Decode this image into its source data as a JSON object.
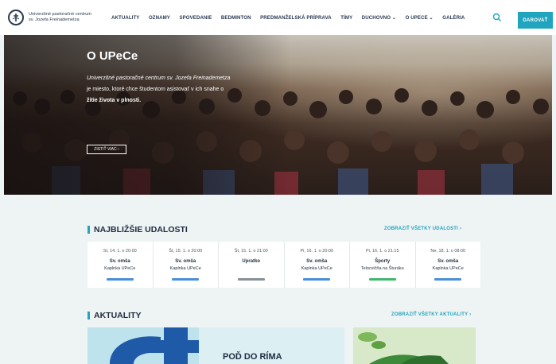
{
  "header": {
    "logo_line1": "Univerzitné pastoračné centrum",
    "logo_line2": "sv. Jozefa Freinademetza",
    "nav": [
      "AKTUALITY",
      "OZNAMY",
      "SPOVEDANIE",
      "BEDMINTON",
      "PREDMANŽELSKÁ PRÍPRAVA",
      "TÍMY",
      "DUCHOVNO ⌄",
      "O UPECE ⌄",
      "GALÉRIA"
    ],
    "donate_label": "DAROVAŤ"
  },
  "hero": {
    "title": "O UPeCe",
    "line1": "Univerzitné pastoračné centrum sv. Jozefa Freinademetza",
    "line2": "je miesto, ktoré chce študentom asistovať v ich snahe o",
    "line3": "žitie života v plnosti.",
    "button": "ZISTIŤ VIAC ›"
  },
  "events": {
    "title": "NAJBLIŽŠIE UDALOSTI",
    "link": "ZOBRAZIŤ VŠETKY UDALOSTI  ›",
    "items": [
      {
        "date": "St, 14. 1. o 20:00",
        "name": "Sv. omša",
        "place": "Kaplnka UPeCe",
        "color": "#4a90d9"
      },
      {
        "date": "Št, 15. 1. o 20:00",
        "name": "Sv. omša",
        "place": "Kaplnka UPeCe",
        "color": "#4a90d9"
      },
      {
        "date": "Št, 15. 1. o 21:00",
        "name": "Upratko",
        "place": "",
        "color": "#8a8f94"
      },
      {
        "date": "Pi, 16. 1. o 20:00",
        "name": "Sv. omša",
        "place": "Kaplnka UPeCe",
        "color": "#4a90d9"
      },
      {
        "date": "Pi, 16. 1. o 21:15",
        "name": "Športy",
        "place": "Telocvičňa na Šturáku",
        "color": "#3fb86a"
      },
      {
        "date": "Ne, 18. 1. o 08:00",
        "name": "Sv. omša",
        "place": "Kaplnka UPeCe",
        "color": "#4a90d9"
      }
    ]
  },
  "news": {
    "title": "AKTUALITY",
    "link": "ZOBRAZIŤ VŠETKY AKTUALITY  ›",
    "card1_text": "POĎ DO RÍMA"
  }
}
